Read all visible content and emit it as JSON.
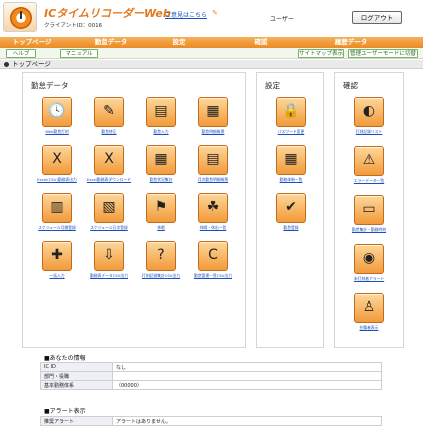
{
  "header": {
    "app_title": "ICタイムリコーダーWeb",
    "client_id": "クライアントID：0016",
    "opinion_link": "ご意見はこちら",
    "user_label": "ユーザー",
    "logout_label": "ログアウト"
  },
  "nav": {
    "tabs": [
      "トップページ",
      "勤怠データ",
      "設定",
      "確認",
      "履歴データ"
    ]
  },
  "subbar": {
    "help": "ヘルプ",
    "manual": "マニュアル",
    "sitemap": "サイトマップ表示",
    "admin_mode": "管理ユーザーモードに切替"
  },
  "page": {
    "title": "トップページ"
  },
  "panels": {
    "attendance": {
      "title": "勤怠データ",
      "items": [
        "Web勤怠打刻",
        "勤怠修正",
        "勤怠入力",
        "勤怠明細帳票",
        "Excel(CSV)勤務表出力",
        "Excel勤務表ダウンロード",
        "勤怠状況集計",
        "月次勤怠明細帳票",
        "スケジュール月間登録",
        "スケジュール日次登録",
        "休暇",
        "休暇・休出一覧",
        "一括入力",
        "勤務表データCSV出力",
        "打刻記録集計CSV出力",
        "勤怠管理一覧CSV出力"
      ]
    },
    "settings": {
      "title": "設定",
      "items": [
        "パスワード変更",
        "勤務体制一覧",
        "勤怠登録"
      ]
    },
    "confirm": {
      "title": "確認",
      "items": [
        "打刻記録リスト",
        "エラーデータ一覧",
        "勤怠集計・勤務時刻",
        "未打刻者アラート",
        "在籍者表示"
      ]
    }
  },
  "info": {
    "title": "■あなたの情報",
    "rows": [
      {
        "key": "IC ID",
        "value": "なし"
      },
      {
        "key": "部門・役職",
        "value": ""
      },
      {
        "key": "基本勤務体系",
        "value": "（00000）"
      }
    ]
  },
  "alert": {
    "title": "■アラート表示",
    "rows": [
      {
        "key": "推奨アラート",
        "value": "アラートはありません。"
      }
    ]
  },
  "icons": {
    "attendance": [
      "clock-icon",
      "pen-edit-icon",
      "document-stamp-icon",
      "calendar-icon",
      "excel-export-icon",
      "excel-download-icon",
      "grid-table-icon",
      "calendar-monthly-icon",
      "calendar-schedule-icon",
      "schedule-daily-icon",
      "vacation-icon",
      "vacation-list-icon",
      "bulk-input-icon",
      "csv-export-icon",
      "help-balloon-icon",
      "csv-list-icon"
    ],
    "settings": [
      "lock-icon",
      "table-icon",
      "checkmark-icon"
    ],
    "confirm": [
      "record-list-icon",
      "error-data-icon",
      "monitor-icon",
      "alarm-light-icon",
      "chair-person-icon"
    ]
  },
  "colors": {
    "accent_orange": "#ea8a25",
    "link_blue": "#1a4fc0",
    "button_green": "#7bb26a"
  }
}
